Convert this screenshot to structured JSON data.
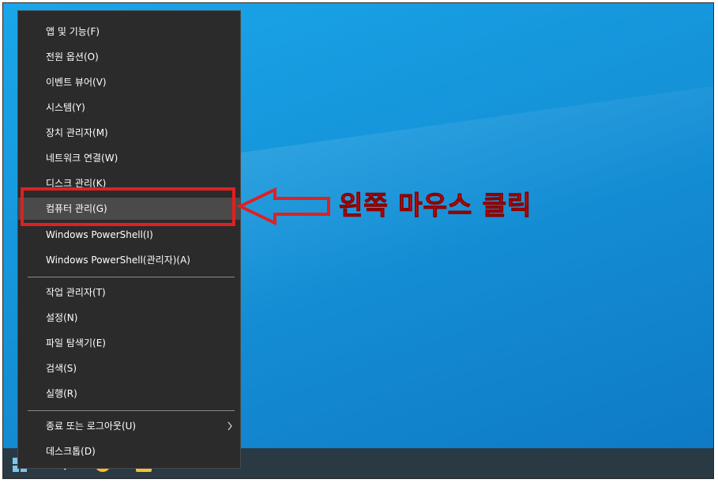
{
  "menu": {
    "items": [
      {
        "label": "앱 및 기능(F)"
      },
      {
        "label": "전원 옵션(O)"
      },
      {
        "label": "이벤트 뷰어(V)"
      },
      {
        "label": "시스템(Y)"
      },
      {
        "label": "장치 관리자(M)"
      },
      {
        "label": "네트워크 연결(W)"
      },
      {
        "label": "디스크 관리(K)"
      },
      {
        "label": "컴퓨터 관리(G)"
      },
      {
        "label": "Windows PowerShell(I)"
      },
      {
        "label": "Windows PowerShell(관리자)(A)"
      },
      {
        "label": "작업 관리자(T)"
      },
      {
        "label": "설정(N)"
      },
      {
        "label": "파일 탐색기(E)"
      },
      {
        "label": "검색(S)"
      },
      {
        "label": "실행(R)"
      },
      {
        "label": "종료 또는 로그아웃(U)"
      },
      {
        "label": "데스크톱(D)"
      }
    ],
    "active_item": "컴퓨터 관리(G)"
  },
  "annotation": {
    "text": "왼쪽 마우스 클릭",
    "color": "#e02020"
  },
  "taskbar": {
    "icons": [
      "windows-start-icon",
      "search-icon",
      "chrome-icon",
      "file-explorer-icon"
    ]
  },
  "colors": {
    "menu_bg": "#2b2b2b",
    "menu_hover": "#4a4a4a",
    "desktop": "#1592d8",
    "highlight": "#e02020"
  }
}
